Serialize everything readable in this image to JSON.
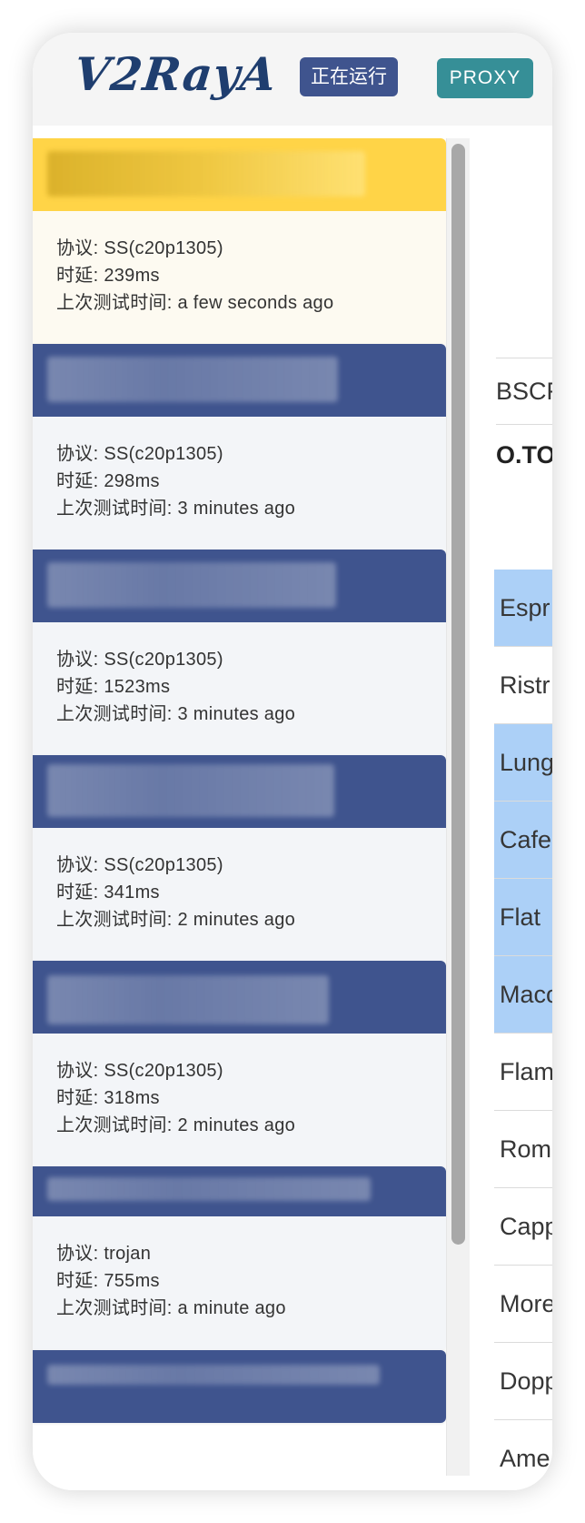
{
  "header": {
    "logo": "V2RayA",
    "status_label": "正在运行",
    "mode_label": "PROXY"
  },
  "colors": {
    "primary": "#3f548e",
    "proxy": "#368f97",
    "active": "#ffd447",
    "selected_row": "#acd0f7"
  },
  "background_table": {
    "header": "BSCR",
    "subtitle": "O.TO",
    "rows": [
      {
        "text": "Espr",
        "selected": true
      },
      {
        "text": "Ristr",
        "selected": false
      },
      {
        "text": "Lung",
        "selected": true
      },
      {
        "text": "Cafe",
        "selected": true
      },
      {
        "text": "Flat",
        "selected": true
      },
      {
        "text": "Maco",
        "selected": true
      },
      {
        "text": "Flam",
        "selected": false
      },
      {
        "text": "Rom",
        "selected": false
      },
      {
        "text": "Capp",
        "selected": false
      },
      {
        "text": "More",
        "selected": false
      },
      {
        "text": "Dopp",
        "selected": false
      },
      {
        "text": "Ame",
        "selected": false
      }
    ]
  },
  "servers": [
    {
      "protocol": "协议: SS(c20p1305)",
      "latency": "时延: 239ms",
      "last_test": "上次测试时间: a few seconds ago",
      "active": true
    },
    {
      "protocol": "协议: SS(c20p1305)",
      "latency": "时延: 298ms",
      "last_test": "上次测试时间: 3 minutes ago",
      "active": false
    },
    {
      "protocol": "协议: SS(c20p1305)",
      "latency": "时延: 1523ms",
      "last_test": "上次测试时间: 3 minutes ago",
      "active": false
    },
    {
      "protocol": "协议: SS(c20p1305)",
      "latency": "时延: 341ms",
      "last_test": "上次测试时间: 2 minutes ago",
      "active": false
    },
    {
      "protocol": "协议: SS(c20p1305)",
      "latency": "时延: 318ms",
      "last_test": "上次测试时间: 2 minutes ago",
      "active": false
    },
    {
      "protocol": "协议: trojan",
      "latency": "时延: 755ms",
      "last_test": "上次测试时间: a minute ago",
      "active": false
    },
    {
      "protocol": "",
      "latency": "",
      "last_test": "",
      "active": false
    }
  ]
}
